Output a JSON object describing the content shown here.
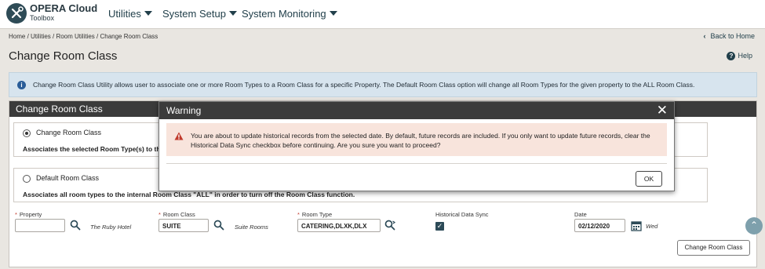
{
  "app": {
    "title": "OPERA Cloud",
    "subtitle": "Toolbox"
  },
  "menu": [
    {
      "label": "Utilities"
    },
    {
      "label": "System Setup"
    },
    {
      "label": "System Monitoring"
    }
  ],
  "breadcrumb": "Home / Utilities / Room Utilities / Change Room Class",
  "back_home": "Back to Home",
  "page_title": "Change Room Class",
  "help": "Help",
  "info_text": "Change Room Class Utility allows user to associate one or more Room Types to a Room Class for a specific Property. The Default Room Class option will change all Room Types for the given property to the ALL Room Class.",
  "panel": {
    "title": "Change Room Class",
    "options": [
      {
        "label": "Change Room Class",
        "selected": true,
        "description": "Associates the selected Room Type(s) to th"
      },
      {
        "label": "Default Room Class",
        "selected": false,
        "description": "Associates all room types to the internal Room Class \"ALL\" in order to turn off the Room Class function."
      }
    ],
    "fields": {
      "property": {
        "label": "Property",
        "value": "",
        "description": "The Ruby Hotel"
      },
      "room_class": {
        "label": "Room Class",
        "value": "SUITE",
        "description": "Suite Rooms"
      },
      "room_type": {
        "label": "Room Type",
        "value": "CATERING,DLXK,DLX"
      },
      "historical": {
        "label": "Historical Data Sync",
        "checked": true
      },
      "date": {
        "label": "Date",
        "value": "02/12/2020",
        "weekday": "Wed"
      }
    },
    "submit_label": "Change Room Class"
  },
  "dialog": {
    "title": "Warning",
    "message": "You are about to update historical records from the selected date. By default, future records are included. If you only want to update future records, clear the Historical Data Sync checkbox before continuing. Are you sure you want to proceed?",
    "ok_label": "OK"
  },
  "colors": {
    "header_dark": "#3b3b3b",
    "info_bg": "#d7e4ee",
    "warning_bg": "#f8e4dc",
    "brand": "#213f4a"
  },
  "icons": [
    "tools-logo-icon",
    "chevron-down-icon",
    "chevron-left-icon",
    "help-icon",
    "info-icon",
    "search-icon",
    "search-refresh-icon",
    "calendar-icon",
    "checkmark-icon",
    "close-icon",
    "warning-icon",
    "chevron-up-icon"
  ]
}
